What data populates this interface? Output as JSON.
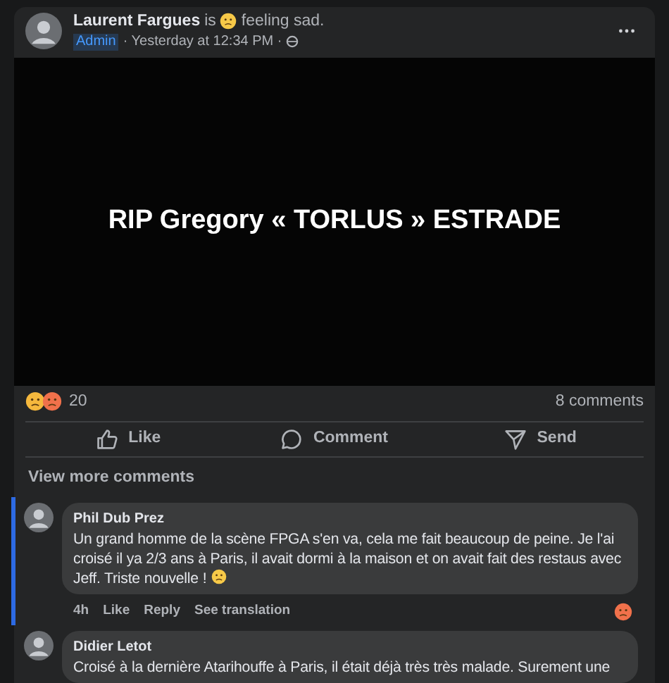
{
  "post": {
    "author": "Laurent Fargues",
    "verb": "is",
    "feeling": "feeling sad.",
    "badge": "Admin",
    "time": "· Yesterday at 12:34 PM ·",
    "media_text": "RIP Gregory « TORLUS » ESTRADE"
  },
  "reactions": {
    "count": "20",
    "comments": "8 comments"
  },
  "actions": [
    {
      "kind": "like",
      "label": "Like"
    },
    {
      "kind": "comment",
      "label": "Comment"
    },
    {
      "kind": "send",
      "label": "Send"
    }
  ],
  "view_more": "View more comments",
  "comments": [
    {
      "author": "Phil Dub Prez",
      "text": "Un grand homme de la scène FPGA s'en va, cela me fait beaucoup de peine. Je l'ai croisé il ya 2/3 ans à Paris, il avait dormi à la maison et on avait fait des restaus avec Jeff. Triste nouvelle !",
      "time": "4h",
      "like": "Like",
      "reply": "Reply",
      "translate": "See translation",
      "highlighted": true,
      "reacted": true
    },
    {
      "author": "Didier Letot",
      "text": "Croisé à la dernière Atarihouffe à Paris, il était déjà très très malade. Surement une",
      "highlighted": false,
      "reacted": false
    }
  ]
}
